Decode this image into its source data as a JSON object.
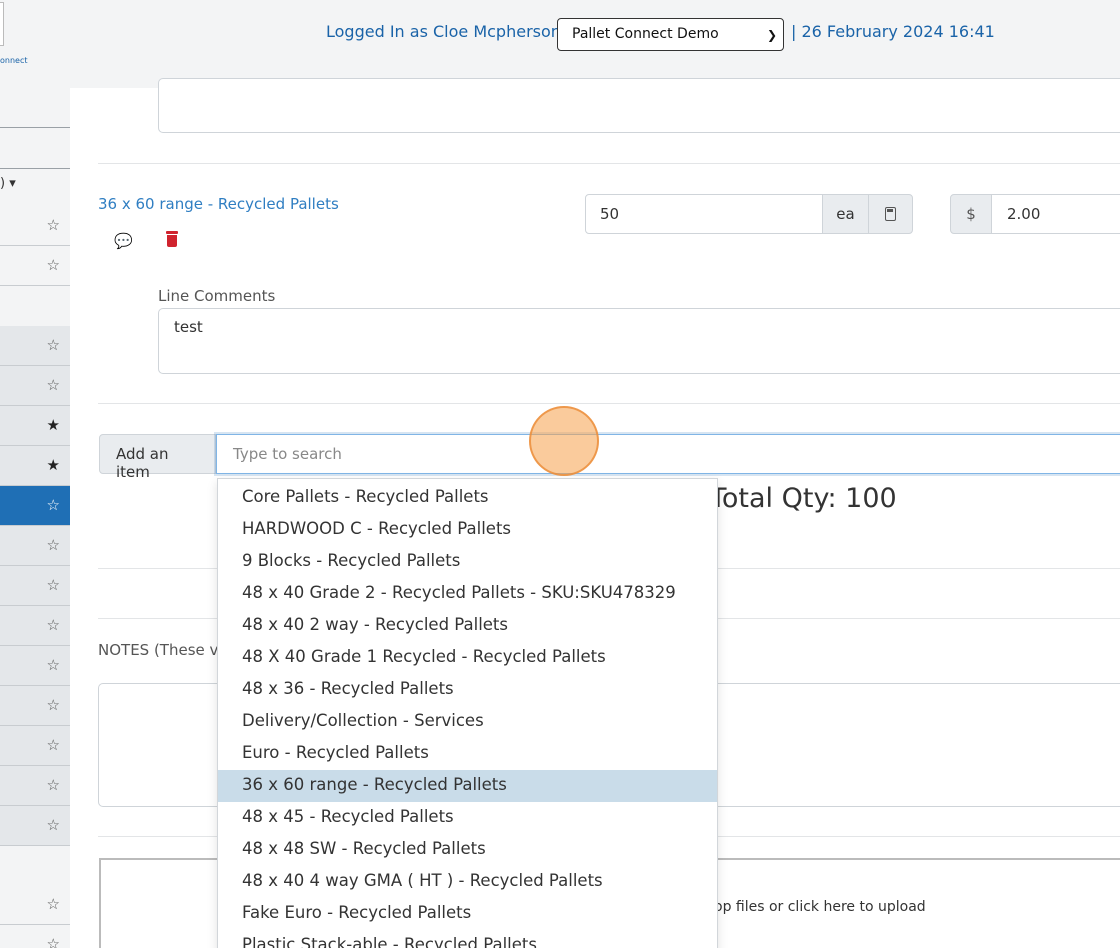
{
  "header": {
    "logo_caption": "onnect",
    "logged_in_text": "Logged In as Cloe Mcpherson |",
    "org_select_value": "Pallet Connect Demo",
    "date_text": "| 26 February 2024 16:41"
  },
  "sidebar": {
    "filter_label": ") ▾"
  },
  "line_item": {
    "name": "36 x 60 range - Recycled Pallets",
    "quantity": "50",
    "unit": "ea",
    "currency_symbol": "$",
    "price": "2.00",
    "line_comments_label": "Line Comments",
    "line_comments_value": "test"
  },
  "add_item": {
    "button_label": "Add an item",
    "search_placeholder": "Type to search"
  },
  "totals": {
    "total_qty_text": "Total Qty: 100"
  },
  "notes": {
    "label": "NOTES (These v"
  },
  "upload": {
    "text": "op files or click here to upload"
  },
  "dropdown": {
    "selected_index": 9,
    "items": [
      "Core Pallets - Recycled Pallets",
      "HARDWOOD C - Recycled Pallets",
      "9 Blocks - Recycled Pallets",
      "48 x 40 Grade 2 - Recycled Pallets - SKU:SKU478329",
      "48 x 40 2 way - Recycled Pallets",
      "48 X 40 Grade 1 Recycled - Recycled Pallets",
      "48 x 36 - Recycled Pallets",
      "Delivery/Collection - Services",
      "Euro - Recycled Pallets",
      "36 x 60 range - Recycled Pallets",
      "48 x 45 - Recycled Pallets",
      "48 x 48 SW - Recycled Pallets",
      "48 x 40 4 way GMA ( HT ) - Recycled Pallets",
      "Fake Euro - Recycled Pallets",
      "Plastic Stack-able - Recycled Pallets"
    ]
  },
  "colors": {
    "link_blue": "#2f7ec2",
    "active_sidebar": "#1f6fb5",
    "delete_red": "#d0232e",
    "selected_option": "#c9dce9"
  }
}
